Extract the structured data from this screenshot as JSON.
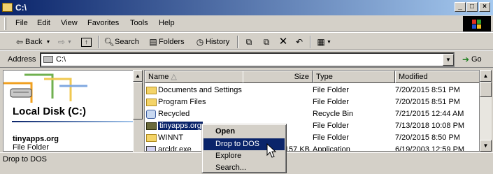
{
  "window": {
    "title": "C:\\"
  },
  "menubar": {
    "items": [
      "File",
      "Edit",
      "View",
      "Favorites",
      "Tools",
      "Help"
    ]
  },
  "toolbar": {
    "back": "Back",
    "search": "Search",
    "folders": "Folders",
    "history": "History"
  },
  "address": {
    "label": "Address",
    "value": "C:\\",
    "go": "Go"
  },
  "leftpane": {
    "heading": "Local Disk (C:)",
    "selected_name": "tinyapps.org",
    "selected_type": "File Folder"
  },
  "columns": {
    "name": "Name",
    "size": "Size",
    "type": "Type",
    "modified": "Modified"
  },
  "files": [
    {
      "name": "Documents and Settings",
      "size": "",
      "type": "File Folder",
      "modified": "7/20/2015 8:51 PM"
    },
    {
      "name": "Program Files",
      "size": "",
      "type": "File Folder",
      "modified": "7/20/2015 8:51 PM"
    },
    {
      "name": "Recycled",
      "size": "",
      "type": "Recycle Bin",
      "modified": "7/21/2015 12:44 AM"
    },
    {
      "name": "tinyapps.org",
      "size": "",
      "type": "File Folder",
      "modified": "7/13/2018 10:08 PM"
    },
    {
      "name": "WINNT",
      "size": "",
      "type": "File Folder",
      "modified": "7/20/2015 8:50 PM"
    },
    {
      "name": "arcldr.exe",
      "size": "157 KB",
      "type": "Application",
      "modified": "6/19/2003 12:59 PM"
    }
  ],
  "context_menu": {
    "items": [
      "Open",
      "Drop to DOS",
      "Explore",
      "Search..."
    ]
  },
  "status": {
    "text": "Drop to DOS"
  },
  "colors": {
    "title_start": "#0a246a",
    "title_end": "#a6caf0",
    "selection": "#0a246a",
    "chrome": "#d4d0c8"
  }
}
